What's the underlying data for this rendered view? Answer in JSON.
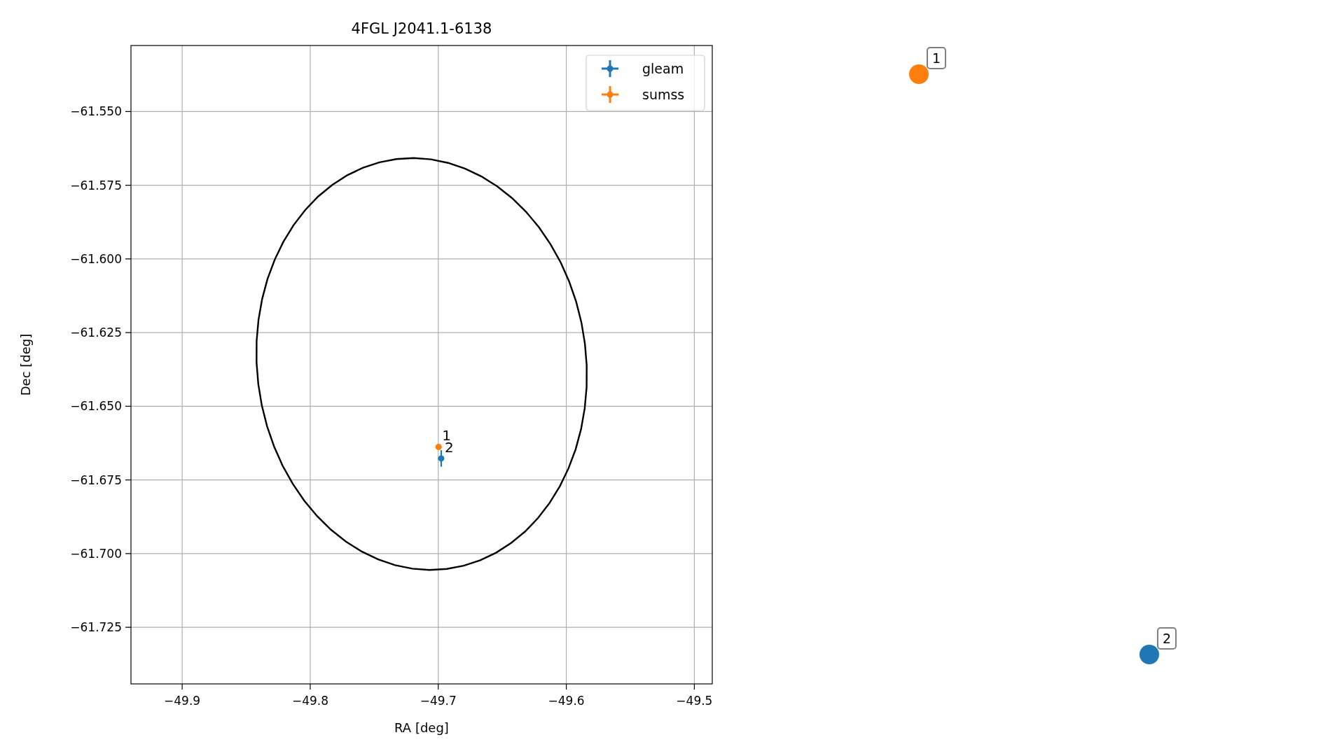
{
  "chart_data": {
    "type": "scatter",
    "title": "4FGL J2041.1-6138",
    "xlabel": "RA [deg]",
    "ylabel": "Dec [deg]",
    "xlim": [
      -49.94,
      -49.486
    ],
    "ylim": [
      -61.7442,
      -61.5276
    ],
    "grid": true,
    "legend": true,
    "xticks": [
      {
        "value": -49.9,
        "label": "−49.9"
      },
      {
        "value": -49.8,
        "label": "−49.8"
      },
      {
        "value": -49.7,
        "label": "−49.7"
      },
      {
        "value": -49.6,
        "label": "−49.6"
      },
      {
        "value": -49.5,
        "label": "−49.5"
      }
    ],
    "yticks": [
      {
        "value": -61.55,
        "label": "−61.550"
      },
      {
        "value": -61.575,
        "label": "−61.575"
      },
      {
        "value": -61.6,
        "label": "−61.600"
      },
      {
        "value": -61.625,
        "label": "−61.625"
      },
      {
        "value": -61.65,
        "label": "−61.650"
      },
      {
        "value": -61.675,
        "label": "−61.675"
      },
      {
        "value": -61.7,
        "label": "−61.700"
      },
      {
        "value": -61.725,
        "label": "−61.725"
      }
    ],
    "series": [
      {
        "name": "gleam",
        "color": "#1f77b4",
        "x": [
          -49.6977
        ],
        "values": [
          -61.6677
        ],
        "errors": [
          0.0028
        ]
      },
      {
        "name": "sumss",
        "color": "#ff7f0e",
        "x": [
          -49.6997
        ],
        "values": [
          -61.6638
        ],
        "errors": [
          0
        ]
      }
    ],
    "annotations": [
      {
        "text": "1",
        "x": -49.6997,
        "y": -61.6638
      },
      {
        "text": "2",
        "x": -49.6977,
        "y": -61.6677
      }
    ]
  },
  "side_markers": [
    {
      "label": "1",
      "color": "#ff7f0e"
    },
    {
      "label": "2",
      "color": "#1f77b4"
    }
  ]
}
